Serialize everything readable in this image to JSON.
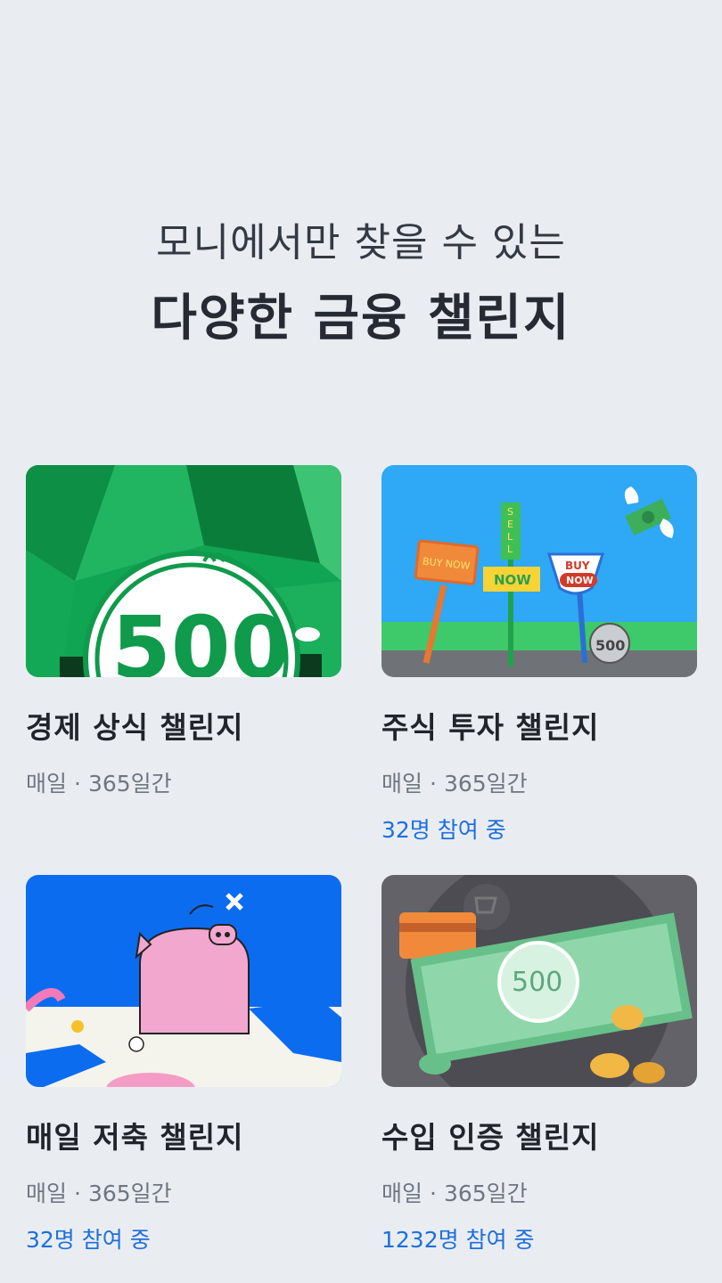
{
  "header": {
    "subtitle": "모니에서만 찾을 수 있는",
    "title": "다양한 금융 챌린지"
  },
  "challenges": [
    {
      "title": "경제 상식 챌린지",
      "frequency": "매일",
      "separator": "·",
      "duration": "365일간",
      "participants": "",
      "image": "green-500-coin-illustration",
      "accent": "#0a9a48",
      "coin_text": "500"
    },
    {
      "title": "주식 투자 챌린지",
      "frequency": "매일",
      "separator": "·",
      "duration": "365일간",
      "participants": "32명 참여 중",
      "image": "stock-signs-illustration",
      "accent": "#2fa8f5",
      "sign_buy_now": "BUY NOW",
      "sign_sell": "SELL",
      "sign_now": "NOW",
      "sign_buy": "BUY",
      "sign_now2": "NOW",
      "coin_text": "500"
    },
    {
      "title": "매일 저축 챌린지",
      "frequency": "매일",
      "separator": "·",
      "duration": "365일간",
      "participants": "32명 참여 중",
      "image": "pink-pig-illustration",
      "accent": "#0c6cf0"
    },
    {
      "title": "수입 인증 챌린지",
      "frequency": "매일",
      "separator": "·",
      "duration": "365일간",
      "participants": "1232명 참여 중",
      "image": "banknote-coins-illustration",
      "accent": "#5c5c62",
      "coin_text": "500"
    }
  ]
}
